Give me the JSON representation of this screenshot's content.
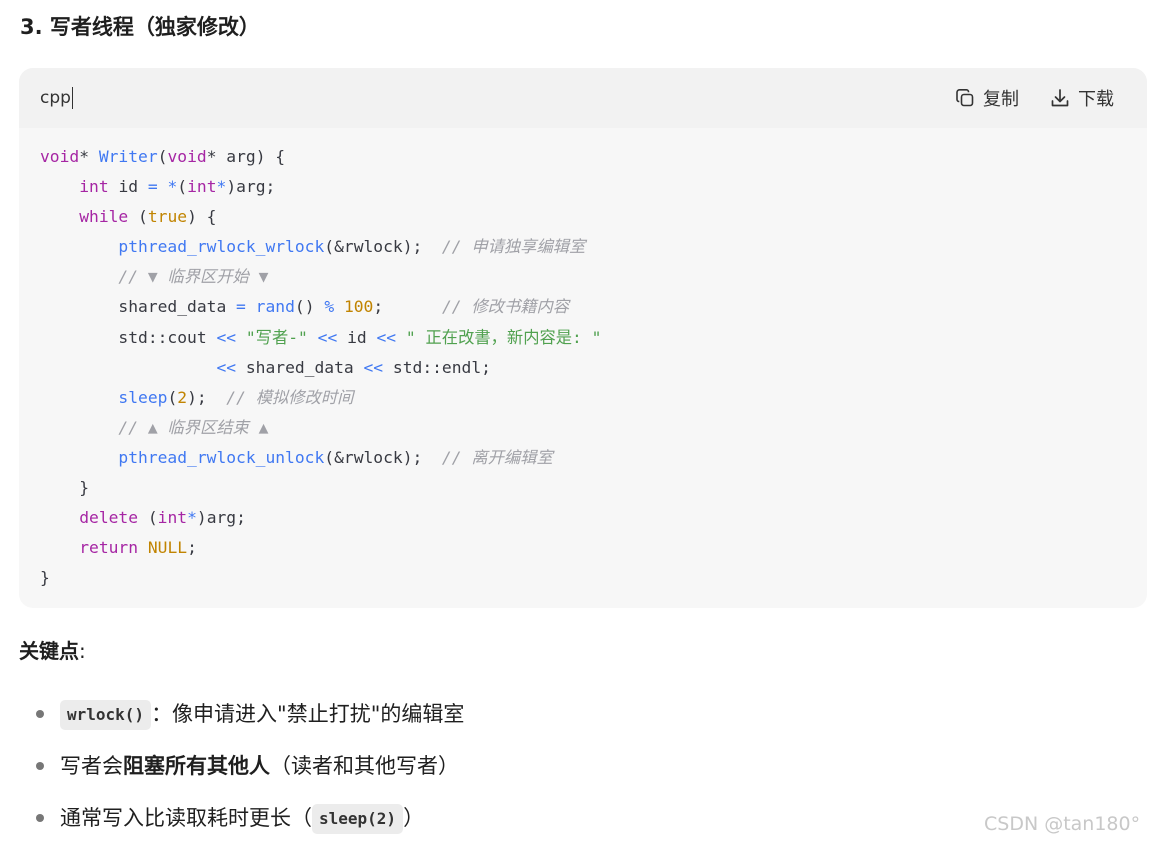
{
  "section": {
    "title": "3. 写者线程（独家修改）"
  },
  "code_block": {
    "language": "cpp",
    "copy_label": "复制",
    "download_label": "下载",
    "lines": [
      [
        [
          "kw",
          "void"
        ],
        [
          "",
          "* "
        ],
        [
          "fn",
          "Writer"
        ],
        [
          "",
          "("
        ],
        [
          "kw",
          "void"
        ],
        [
          "",
          "* arg) {"
        ]
      ],
      [
        [
          "",
          "    "
        ],
        [
          "kw",
          "int"
        ],
        [
          "",
          " id "
        ],
        [
          "op",
          "="
        ],
        [
          "",
          " "
        ],
        [
          "op",
          "*"
        ],
        [
          "",
          "("
        ],
        [
          "kw",
          "int"
        ],
        [
          "op",
          "*"
        ],
        [
          "",
          ")arg;"
        ]
      ],
      [
        [
          "",
          "    "
        ],
        [
          "kw",
          "while"
        ],
        [
          "",
          " ("
        ],
        [
          "num",
          "true"
        ],
        [
          "",
          ") {"
        ]
      ],
      [
        [
          "",
          "        "
        ],
        [
          "fn",
          "pthread_rwlock_wrlock"
        ],
        [
          "",
          "(&rwlock);  "
        ],
        [
          "cm",
          "// 申请独享编辑室"
        ]
      ],
      [
        [
          "",
          "        "
        ],
        [
          "cm",
          "// ▼ 临界区开始 ▼"
        ]
      ],
      [
        [
          "",
          "        shared_data "
        ],
        [
          "op",
          "="
        ],
        [
          "",
          " "
        ],
        [
          "fn",
          "rand"
        ],
        [
          "",
          "() "
        ],
        [
          "op",
          "%"
        ],
        [
          "",
          " "
        ],
        [
          "num",
          "100"
        ],
        [
          "",
          ";      "
        ],
        [
          "cm",
          "// 修改书籍内容"
        ]
      ],
      [
        [
          "",
          "        std::cout "
        ],
        [
          "op",
          "<<"
        ],
        [
          "",
          " "
        ],
        [
          "str",
          "\"写者-\""
        ],
        [
          "",
          " "
        ],
        [
          "op",
          "<<"
        ],
        [
          "",
          " id "
        ],
        [
          "op",
          "<<"
        ],
        [
          "",
          " "
        ],
        [
          "str",
          "\" 正在改書，新内容是: \""
        ]
      ],
      [
        [
          "",
          "                  "
        ],
        [
          "op",
          "<<"
        ],
        [
          "",
          " shared_data "
        ],
        [
          "op",
          "<<"
        ],
        [
          "",
          " std::endl;"
        ]
      ],
      [
        [
          "",
          "        "
        ],
        [
          "fn",
          "sleep"
        ],
        [
          "",
          "("
        ],
        [
          "num",
          "2"
        ],
        [
          "",
          ");  "
        ],
        [
          "cm",
          "// 模拟修改时间"
        ]
      ],
      [
        [
          "",
          "        "
        ],
        [
          "cm",
          "// ▲ 临界区结束 ▲"
        ]
      ],
      [
        [
          "",
          "        "
        ],
        [
          "fn",
          "pthread_rwlock_unlock"
        ],
        [
          "",
          "(&rwlock);  "
        ],
        [
          "cm",
          "// 离开编辑室"
        ]
      ],
      [
        [
          "",
          "    }"
        ]
      ],
      [
        [
          "",
          "    "
        ],
        [
          "kw",
          "delete"
        ],
        [
          "",
          " ("
        ],
        [
          "kw",
          "int"
        ],
        [
          "op",
          "*"
        ],
        [
          "",
          ")arg;"
        ]
      ],
      [
        [
          "",
          "    "
        ],
        [
          "kw",
          "return"
        ],
        [
          "",
          " "
        ],
        [
          "num",
          "NULL"
        ],
        [
          "",
          ";"
        ]
      ],
      [
        [
          "",
          "}"
        ]
      ]
    ]
  },
  "keypoints": {
    "label_bold": "关键点",
    "label_colon": ":",
    "items": [
      {
        "code": "wrlock()",
        "text": "：像申请进入\"禁止打扰\"的编辑室"
      },
      {
        "pre": "写者会",
        "bold": "阻塞所有其他人",
        "post": "（读者和其他写者）"
      },
      {
        "pre": "通常写入比读取耗时更长（",
        "code": "sleep(2)",
        "post": "）"
      }
    ]
  },
  "watermark": "CSDN @tan180°",
  "icons": {
    "copy": "copy-icon",
    "download": "download-icon"
  }
}
